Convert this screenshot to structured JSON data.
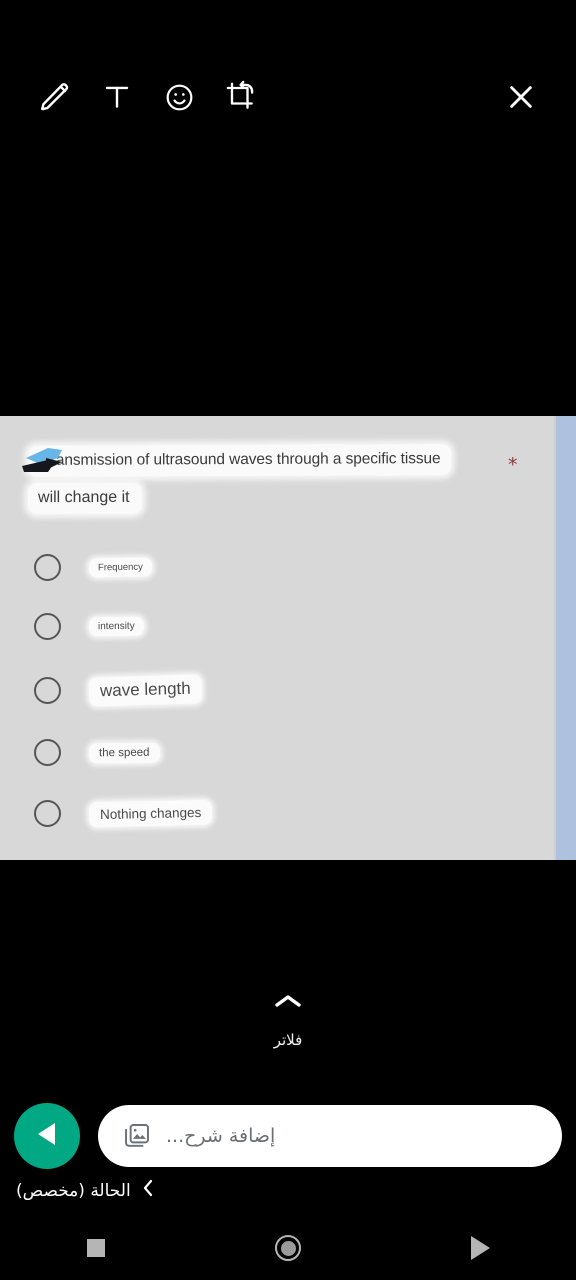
{
  "app": {
    "screen_name": "image-editor-caption",
    "accent_green": "#00a884",
    "canvas_background": "#d8d8d8",
    "edge_strip_color": "#aec1de"
  },
  "editor_toolbar": {
    "tools": [
      {
        "name": "draw-icon",
        "label": "Draw"
      },
      {
        "name": "text-icon",
        "label": "T"
      },
      {
        "name": "sticker-icon",
        "label": "Sticker"
      },
      {
        "name": "crop-rotate-icon",
        "label": "Crop & rotate"
      }
    ],
    "close_label": "Close"
  },
  "image": {
    "question": {
      "line1": "Transmission of ultrasound waves through a specific tissue",
      "line2": "will change it",
      "required_marker": "*",
      "required_marker_color": "#8c3a3a"
    },
    "options": [
      {
        "label": "Frequency",
        "selected": false
      },
      {
        "label": "intensity",
        "selected": false
      },
      {
        "label": "wave length",
        "selected": false
      },
      {
        "label": "the speed",
        "selected": false
      },
      {
        "label": "Nothing changes",
        "selected": false
      }
    ],
    "annotation": "blue-black-arrow-scribble"
  },
  "filters": {
    "label": "فلاتر",
    "chevron": "chevron-up"
  },
  "caption": {
    "placeholder": "إضافة شرح...",
    "value": "",
    "gallery_icon_label": "Add photo",
    "send_label": "Send"
  },
  "destination": {
    "label": "الحالة (مخصص)",
    "chevron": "chevron-left"
  },
  "nav_bar": {
    "recents_label": "Recents",
    "home_label": "Home",
    "back_label": "Back"
  }
}
